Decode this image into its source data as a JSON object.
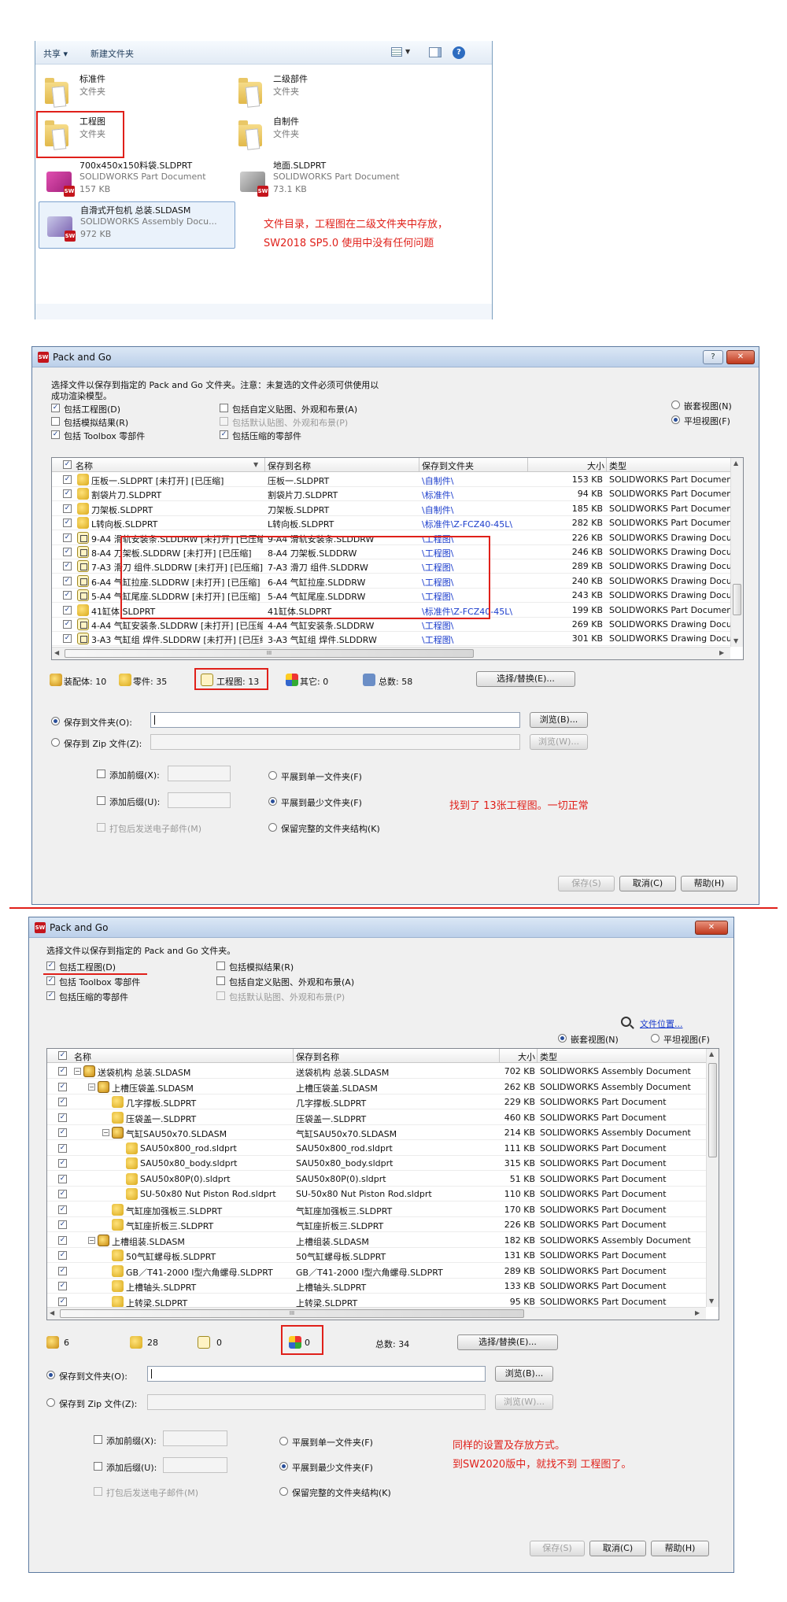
{
  "explorer": {
    "toolbar": {
      "share": "共享 ▾",
      "new_folder": "新建文件夹"
    },
    "items": [
      {
        "name": "标准件",
        "type": "文件夹",
        "size": ""
      },
      {
        "name": "二级部件",
        "type": "文件夹",
        "size": ""
      },
      {
        "name": "工程图",
        "type": "文件夹",
        "size": ""
      },
      {
        "name": "自制件",
        "type": "文件夹",
        "size": ""
      },
      {
        "name": "700x450x150料袋.SLDPRT",
        "type": "SOLIDWORKS Part Document",
        "size": "157 KB"
      },
      {
        "name": "地面.SLDPRT",
        "type": "SOLIDWORKS Part Document",
        "size": "73.1 KB"
      },
      {
        "name": "自滑式开包机 总装.SLDASM",
        "type": "SOLIDWORKS Assembly Docu...",
        "size": "972 KB"
      }
    ],
    "note": [
      "文件目录，工程图在二级文件夹中存放，",
      "SW2018 SP5.0 使用中没有任何问题"
    ]
  },
  "dialog1": {
    "title": "Pack and Go",
    "help_btn": "?",
    "close_btn": "✕",
    "intro": [
      "选择文件以保存到指定的 Pack and Go 文件夹。注意：未复选的文件必须可供使用以",
      "成功渲染模型。"
    ],
    "options": {
      "include_drawings": "包括工程图(D)",
      "include_sim": "包括模拟结果(R)",
      "include_toolbox": "包括 Toolbox 零部件",
      "include_decals": "包括自定义贴图、外观和布景(A)",
      "default_decals": "包括默认贴图、外观和布景(P)",
      "include_suppressed": "包括压缩的零部件"
    },
    "view": {
      "nested": "嵌套视图(N)",
      "flat": "平坦视图(F)"
    },
    "columns": [
      "名称",
      "保存到名称",
      "保存到文件夹",
      "大小",
      "类型"
    ],
    "rows": [
      {
        "name": "压板一.SLDPRT [未打开] [已压缩]",
        "save_name": "压板一.SLDPRT",
        "folder": "\\自制件\\",
        "size": "153 KB",
        "type": "SOLIDWORKS Part Document",
        "kind": "part"
      },
      {
        "name": "割袋片刀.SLDPRT",
        "save_name": "割袋片刀.SLDPRT",
        "folder": "\\标准件\\",
        "size": "94 KB",
        "type": "SOLIDWORKS Part Document",
        "kind": "part"
      },
      {
        "name": "刀架板.SLDPRT",
        "save_name": "刀架板.SLDPRT",
        "folder": "\\自制件\\",
        "size": "185 KB",
        "type": "SOLIDWORKS Part Document",
        "kind": "part"
      },
      {
        "name": "L转向板.SLDPRT",
        "save_name": "L转向板.SLDPRT",
        "folder": "\\标准件\\Z-FCZ40-45L\\",
        "size": "282 KB",
        "type": "SOLIDWORKS Part Document",
        "kind": "part"
      },
      {
        "name": "9-A4 滑轨安装条.SLDDRW [未打开] [已压缩]",
        "save_name": "9-A4 滑轨安装条.SLDDRW",
        "folder": "\\工程图\\",
        "size": "226 KB",
        "type": "SOLIDWORKS Drawing Document",
        "kind": "drw"
      },
      {
        "name": "8-A4 刀架板.SLDDRW [未打开] [已压缩]",
        "save_name": "8-A4 刀架板.SLDDRW",
        "folder": "\\工程图\\",
        "size": "246 KB",
        "type": "SOLIDWORKS Drawing Document",
        "kind": "drw"
      },
      {
        "name": "7-A3 滑刀 组件.SLDDRW [未打开] [已压缩]",
        "save_name": "7-A3 滑刀 组件.SLDDRW",
        "folder": "\\工程图\\",
        "size": "289 KB",
        "type": "SOLIDWORKS Drawing Document",
        "kind": "drw"
      },
      {
        "name": "6-A4 气缸拉座.SLDDRW [未打开] [已压缩]",
        "save_name": "6-A4 气缸拉座.SLDDRW",
        "folder": "\\工程图\\",
        "size": "240 KB",
        "type": "SOLIDWORKS Drawing Document",
        "kind": "drw"
      },
      {
        "name": "5-A4 气缸尾座.SLDDRW [未打开] [已压缩]",
        "save_name": "5-A4 气缸尾座.SLDDRW",
        "folder": "\\工程图\\",
        "size": "243 KB",
        "type": "SOLIDWORKS Drawing Document",
        "kind": "drw"
      },
      {
        "name": "41缸体.SLDPRT",
        "save_name": "41缸体.SLDPRT",
        "folder": "\\标准件\\Z-FCZ40-45L\\",
        "size": "199 KB",
        "type": "SOLIDWORKS Part Document",
        "kind": "part"
      },
      {
        "name": "4-A4 气缸安装条.SLDDRW [未打开] [已压缩]",
        "save_name": "4-A4 气缸安装条.SLDDRW",
        "folder": "\\工程图\\",
        "size": "269 KB",
        "type": "SOLIDWORKS Drawing Document",
        "kind": "drw"
      },
      {
        "name": "3-A3 气缸组 焊件.SLDDRW [未打开] [已压缩]",
        "save_name": "3-A3 气缸组 焊件.SLDDRW",
        "folder": "\\工程图\\",
        "size": "301 KB",
        "type": "SOLIDWORKS Drawing Document",
        "kind": "drw"
      }
    ],
    "hscroll_mark": "III",
    "summary": {
      "assemblies": "装配体: 10",
      "parts": "零件: 35",
      "drawings": "工程图: 13",
      "others": "其它: 0",
      "total": "总数: 58"
    },
    "select_replace": "选择/替换(E)...",
    "save_folder": "保存到文件夹(O):",
    "save_zip": "保存到 Zip 文件(Z):",
    "browse": "浏览(B)...",
    "browse_w": "浏览(W)...",
    "add_prefix": "添加前缀(X):",
    "add_suffix": "添加后缀(U):",
    "email": "打包后发送电子邮件(M)",
    "flat_single": "平展到单一文件夹(F)",
    "flat_min": "平展到最少文件夹(F)",
    "keep_struct": "保留完整的文件夹结构(K)",
    "save_btn": "保存(S)",
    "cancel_btn": "取消(C)",
    "help_btn2": "帮助(H)",
    "note": "找到了 13张工程图。一切正常"
  },
  "dialog2": {
    "title": "Pack and Go",
    "close_btn": "✕",
    "intro": "选择文件以保存到指定的 Pack and Go 文件夹。",
    "options": {
      "include_drawings": "包括工程图(D)",
      "include_toolbox": "包括 Toolbox 零部件",
      "include_suppressed": "包括压缩的零部件",
      "include_sim": "包括模拟结果(R)",
      "include_decals": "包括自定义贴图、外观和布景(A)",
      "default_decals": "包括默认贴图、外观和布景(P)"
    },
    "file_location": "文件位置...",
    "view": {
      "nested": "嵌套视图(N)",
      "flat": "平坦视图(F)"
    },
    "columns": [
      "名称",
      "保存到名称",
      "大小",
      "类型"
    ],
    "rows": [
      {
        "name": "送袋机构 总装.SLDASM",
        "save_name": "送袋机构 总装.SLDASM",
        "size": "702 KB",
        "type": "SOLIDWORKS Assembly Document",
        "kind": "asm",
        "level": 0,
        "tree": "−"
      },
      {
        "name": "上槽压袋盖.SLDASM",
        "save_name": "上槽压袋盖.SLDASM",
        "size": "262 KB",
        "type": "SOLIDWORKS Assembly Document",
        "kind": "asm",
        "level": 1,
        "tree": "−"
      },
      {
        "name": "几字撑板.SLDPRT",
        "save_name": "几字撑板.SLDPRT",
        "size": "229 KB",
        "type": "SOLIDWORKS Part Document",
        "kind": "part",
        "level": 2,
        "tree": ""
      },
      {
        "name": "压袋盖一.SLDPRT",
        "save_name": "压袋盖一.SLDPRT",
        "size": "460 KB",
        "type": "SOLIDWORKS Part Document",
        "kind": "part",
        "level": 2,
        "tree": ""
      },
      {
        "name": "气缸SAU50x70.SLDASM",
        "save_name": "气缸SAU50x70.SLDASM",
        "size": "214 KB",
        "type": "SOLIDWORKS Assembly Document",
        "kind": "asm",
        "level": 2,
        "tree": "−"
      },
      {
        "name": "SAU50x800_rod.sldprt",
        "save_name": "SAU50x800_rod.sldprt",
        "size": "111 KB",
        "type": "SOLIDWORKS Part Document",
        "kind": "part",
        "level": 3,
        "tree": ""
      },
      {
        "name": "SAU50x80_body.sldprt",
        "save_name": "SAU50x80_body.sldprt",
        "size": "315 KB",
        "type": "SOLIDWORKS Part Document",
        "kind": "part",
        "level": 3,
        "tree": ""
      },
      {
        "name": "SAU50x80P(0).sldprt",
        "save_name": "SAU50x80P(0).sldprt",
        "size": "51 KB",
        "type": "SOLIDWORKS Part Document",
        "kind": "part",
        "level": 3,
        "tree": ""
      },
      {
        "name": "SU-50x80  Nut Piston Rod.sldprt",
        "save_name": "SU-50x80  Nut Piston Rod.sldprt",
        "size": "110 KB",
        "type": "SOLIDWORKS Part Document",
        "kind": "part",
        "level": 3,
        "tree": ""
      },
      {
        "name": "气缸座加强板三.SLDPRT",
        "save_name": "气缸座加强板三.SLDPRT",
        "size": "170 KB",
        "type": "SOLIDWORKS Part Document",
        "kind": "part",
        "level": 2,
        "tree": ""
      },
      {
        "name": "气缸座折板三.SLDPRT",
        "save_name": "气缸座折板三.SLDPRT",
        "size": "226 KB",
        "type": "SOLIDWORKS Part Document",
        "kind": "part",
        "level": 2,
        "tree": ""
      },
      {
        "name": "上槽组装.SLDASM",
        "save_name": "上槽组装.SLDASM",
        "size": "182 KB",
        "type": "SOLIDWORKS Assembly Document",
        "kind": "asm",
        "level": 1,
        "tree": "−"
      },
      {
        "name": "50气缸螺母板.SLDPRT",
        "save_name": "50气缸螺母板.SLDPRT",
        "size": "131 KB",
        "type": "SOLIDWORKS Part Document",
        "kind": "part",
        "level": 2,
        "tree": ""
      },
      {
        "name": "GB／T41-2000 I型六角螺母.SLDPRT",
        "save_name": "GB／T41-2000 I型六角螺母.SLDPRT",
        "size": "289 KB",
        "type": "SOLIDWORKS Part Document",
        "kind": "part",
        "level": 2,
        "tree": ""
      },
      {
        "name": "上槽轴头.SLDPRT",
        "save_name": "上槽轴头.SLDPRT",
        "size": "133 KB",
        "type": "SOLIDWORKS Part Document",
        "kind": "part",
        "level": 2,
        "tree": ""
      },
      {
        "name": "上转梁.SLDPRT",
        "save_name": "上转梁.SLDPRT",
        "size": "95 KB",
        "type": "SOLIDWORKS Part Document",
        "kind": "part",
        "level": 2,
        "tree": ""
      }
    ],
    "hscroll_mark": "III",
    "summary": {
      "assemblies": "6",
      "parts": "28",
      "drawings": "0",
      "others": "0",
      "total": "总数: 34"
    },
    "select_replace": "选择/替换(E)...",
    "save_folder": "保存到文件夹(O):",
    "save_zip": "保存到 Zip 文件(Z):",
    "browse": "浏览(B)...",
    "browse_w": "浏览(W)...",
    "add_prefix": "添加前缀(X):",
    "add_suffix": "添加后缀(U):",
    "email": "打包后发送电子邮件(M)",
    "flat_single": "平展到单一文件夹(F)",
    "flat_min": "平展到最少文件夹(F)",
    "keep_struct": "保留完整的文件夹结构(K)",
    "save_btn": "保存(S)",
    "cancel_btn": "取消(C)",
    "help_btn2": "帮助(H)",
    "note": [
      "同样的设置及存放方式。",
      "到SW2020版中，就找不到 工程图了。"
    ]
  },
  "colors": {
    "annotation": "#e0201a",
    "link": "#1a3ccc"
  }
}
